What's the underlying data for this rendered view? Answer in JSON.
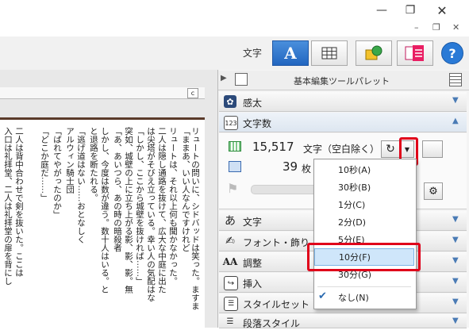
{
  "toolbar": {
    "label": "文字"
  },
  "help": "?",
  "ruler_c": "c",
  "palette": {
    "title": "基本編集ツールパレット"
  },
  "sections": {
    "kanta": "感太",
    "count": "文字数",
    "moji": "文字",
    "font": "フォント・飾り",
    "chosei": "調整",
    "sonyu": "挿入",
    "style": "スタイルセット",
    "danraku": "段落スタイル"
  },
  "count": {
    "chars_value": "15,517",
    "chars_label": "文字（空白除く）",
    "pages_value": "39",
    "pages_label": "枚"
  },
  "menu": {
    "items": [
      "10秒(A)",
      "30秒(B)",
      "1分(C)",
      "2分(D)",
      "5分(E)",
      "10分(F)",
      "30分(G)",
      "なし(N)"
    ],
    "selected": "10分(F)",
    "checked": "なし(N)"
  },
  "document": {
    "columns": [
      "リュートの問いに、シドバッドは笑った。ますま",
      "「ままあ、いい人なんですけれど",
      "リュートは、それ以上何も聞かなかった。",
      "二人は隠し通路を抜けて、広大な中庭に出た",
      "は尖塔がそびえ立っている。幸い人の気配はな",
      "「しかし、ここから城壁を抜ければ……」",
      "突如、城壁の上に立ち上がる影、影、影。無",
      "「あ、あいつら、あの時の暗殺者",
      "しかし、今度は数が違う。数十人はいる。と",
      "と退路を断たれる。",
      "「逃げ道はない……おとなしく",
      "アルウィン騎士団",
      "「ばれてやがったのか」",
      "「どこか庭だ……」",
      "二人は背中合わせで剣を抜いた。ここは",
      "入口は礼拝堂、二人は礼拝堂の扉を背にし"
    ]
  }
}
